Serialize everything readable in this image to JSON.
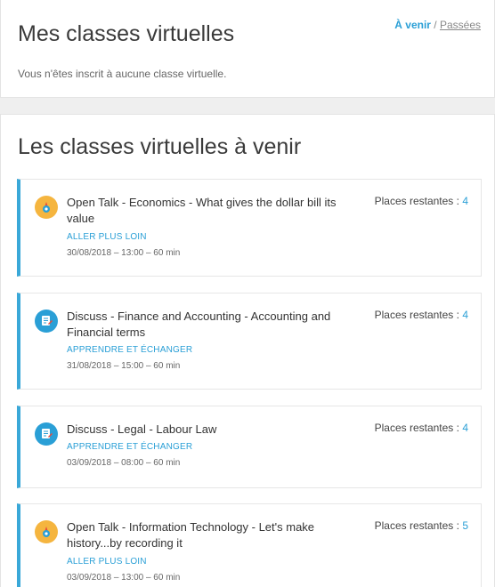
{
  "mine": {
    "title": "Mes classes virtuelles",
    "filter_active": "À venir",
    "filter_separator": " / ",
    "filter_past": "Passées",
    "empty_message": "Vous n'êtes inscrit à aucune classe virtuelle."
  },
  "upcoming": {
    "title": "Les classes virtuelles à venir",
    "places_label": "Places restantes : ",
    "items": [
      {
        "icon": "open-talk-icon",
        "title": "Open Talk - Economics - What gives the dollar bill its value",
        "category": "ALLER PLUS LOIN",
        "date": "30/08/2018 – 13:00 – 60 min",
        "places": "4"
      },
      {
        "icon": "discuss-icon",
        "title": "Discuss - Finance and Accounting - Accounting and Financial terms",
        "category": "APPRENDRE ET ÉCHANGER",
        "date": "31/08/2018 – 15:00 – 60 min",
        "places": "4"
      },
      {
        "icon": "discuss-icon",
        "title": "Discuss - Legal - Labour Law",
        "category": "APPRENDRE ET ÉCHANGER",
        "date": "03/09/2018 – 08:00 – 60 min",
        "places": "4"
      },
      {
        "icon": "open-talk-icon",
        "title": "Open Talk - Information Technology - Let's make history...by recording it",
        "category": "ALLER PLUS LOIN",
        "date": "03/09/2018 – 13:00 – 60 min",
        "places": "5"
      }
    ]
  },
  "colors": {
    "accent": "#2a9fd6",
    "talk_icon": "#f5b53f",
    "card_border": "#3aa8d8"
  }
}
